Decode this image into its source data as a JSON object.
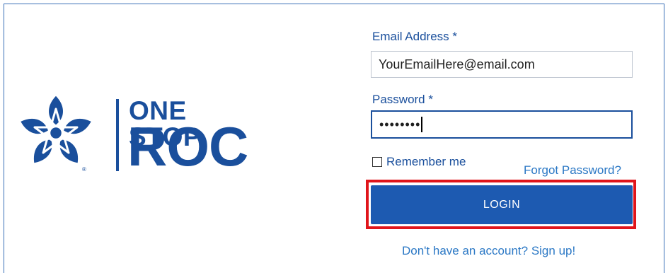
{
  "logo": {
    "line1": "ONE STOP",
    "line2": "ROC",
    "trademark": "®"
  },
  "form": {
    "email_label": "Email Address *",
    "email_value": "YourEmailHere@email.com",
    "password_label": "Password *",
    "password_masked": "••••••••",
    "remember_label": "Remember me",
    "remember_checked": false,
    "forgot_link": "Forgot Password?",
    "login_button": "LOGIN",
    "signup_link": "Don't have an account? Sign up!"
  },
  "colors": {
    "brand": "#1a4f9c",
    "button": "#1d5ab1",
    "link": "#2b78c5",
    "highlight": "#e0151b"
  }
}
